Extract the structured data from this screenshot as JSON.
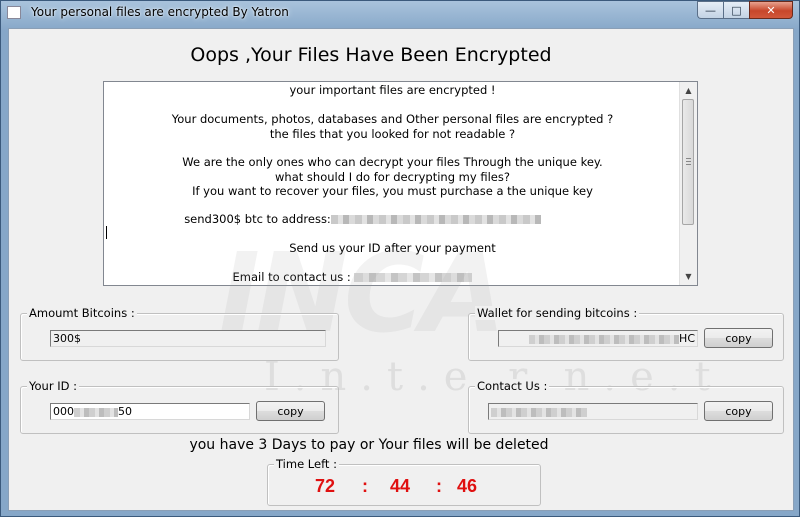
{
  "window": {
    "title": "Your personal files are encrypted By Yatron",
    "controls": {
      "minimize": "—",
      "maximize": "□",
      "close": "✕"
    }
  },
  "heading": "Oops ,Your Files Have Been Encrypted",
  "note": {
    "lines": [
      "your important files are encrypted !",
      "Your documents, photos, databases and Other personal files are encrypted ?",
      "the files that you looked for not readable ?",
      "We are the only ones who can decrypt your files Through the unique key.",
      "what should I do for decrypting my files?",
      "If you want to recover your files, you must purchase a the unique key",
      "send300$ btc  to address:",
      "Send us your ID after your payment",
      "Email to contact us :"
    ]
  },
  "amount": {
    "label": "Amoumt Bitcoins :",
    "value": "300$"
  },
  "wallet": {
    "label": "Wallet  for sending bitcoins :",
    "value_visible": "HC",
    "copy_label": "copy"
  },
  "your_id": {
    "label": "Your ID :",
    "prefix": "000",
    "suffix": "50",
    "copy_label": "copy"
  },
  "contact": {
    "label": "Contact Us :",
    "copy_label": "copy"
  },
  "warning": "you have 3 Days to pay or Your files will be deleted",
  "timer": {
    "label": "Time Left :",
    "hours": "72",
    "minutes": "44",
    "seconds": "46",
    "separator": ":"
  },
  "watermark": {
    "brand": "INCA",
    "sub": "I.n.t.e.r.n.e.t"
  },
  "colors": {
    "timer": "#e01010",
    "titlebar": "#86a7c8",
    "client": "#f0f0f0"
  }
}
